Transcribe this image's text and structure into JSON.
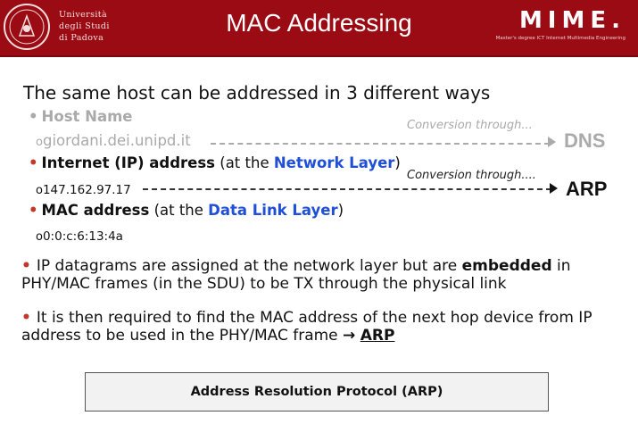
{
  "header": {
    "title": "MAC Addressing",
    "university": [
      "Università",
      "degli Studi",
      "di Padova"
    ],
    "brand": "MIME.",
    "brand_subtitle": "Master's degree ICT Internet Multimedia Engineering",
    "colors": {
      "bar": "#9b0b14"
    }
  },
  "intro": "The same host can be addressed in 3 different ways",
  "ways": [
    {
      "label": "Host Name",
      "example": "giordani.dei.unipd.it",
      "conversion": "Conversion through...",
      "target": "DNS"
    },
    {
      "label": "Internet (IP) address",
      "qualifier_open": " (at the ",
      "layer": "Network Layer",
      "qualifier_close": ")",
      "example": "147.162.97.17",
      "conversion": "Conversion through....",
      "target": "ARP"
    },
    {
      "label": "MAC address",
      "qualifier_open": " (at the ",
      "layer": "Data Link Layer",
      "qualifier_close": ")",
      "example": "0:0:c:6:13:4a"
    }
  ],
  "points": [
    {
      "before": "IP datagrams are assigned at the network layer but are ",
      "bold": "embedded",
      "after": " in PHY/MAC frames (in the SDU) to be TX through the physical link"
    },
    {
      "before": "It is then required to find the MAC address of the next hop device from IP address to be used in the PHY/MAC frame ",
      "arrow": "→",
      "link": "ARP"
    }
  ],
  "box_label": "Address Resolution Protocol (ARP)",
  "bullet_char": "•",
  "sub_bullet_char": "o"
}
